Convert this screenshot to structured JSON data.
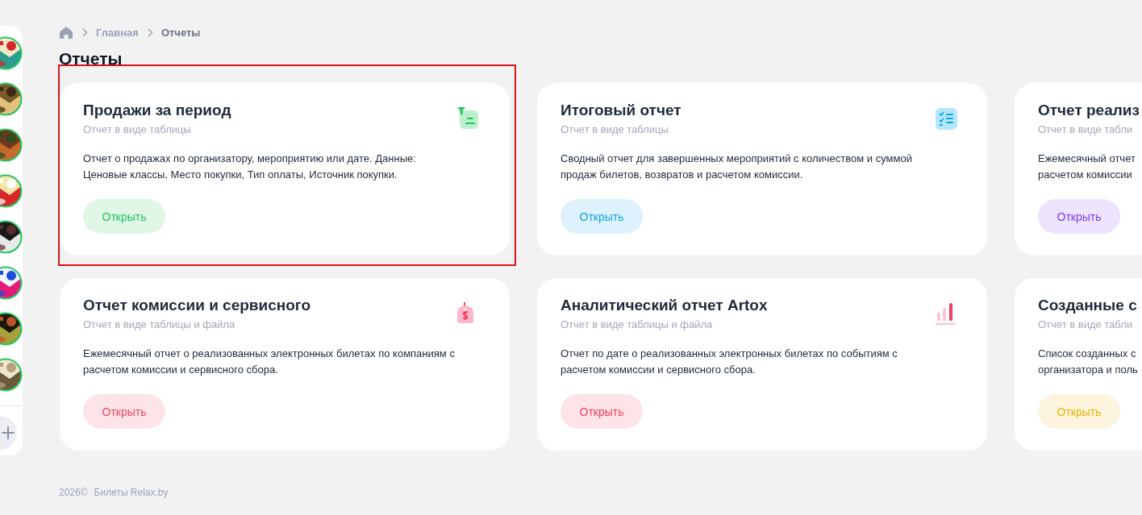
{
  "sidebar": {
    "add_button": "+"
  },
  "breadcrumb": [
    "Главная",
    "Отчеты"
  ],
  "title": "Отчеты",
  "cards": [
    {
      "title": "Продажи за период",
      "subtitle": "Отчет в виде таблицы",
      "description": [
        "Отчет о продажах по организатору, мероприятию или дате. Данные:",
        "Ценовые классы, Место покупки, Тип оплаты, Источник покупки."
      ],
      "button": "Открыть",
      "color": "#22c55e",
      "highlighted": true
    },
    {
      "title": "Итоговый отчет",
      "subtitle": "Отчет в виде таблицы",
      "description": [
        "Сводный отчет для завершенных мероприятий с количеством и суммой",
        "продаж билетов, возвратов и расчетом комиссии."
      ],
      "button": "Открыть",
      "color": "#0ea5e9",
      "highlighted": false
    },
    {
      "title": "Отчет реализ",
      "subtitle": "Отчет в виде табли",
      "description": [
        "Ежемесячный отчет",
        "расчетом комиссии"
      ],
      "button": "Открыть",
      "color": "#7c3aed",
      "highlighted": false
    },
    {
      "title": "Отчет комиссии и сервисного",
      "subtitle": "Отчет в виде таблицы и файла",
      "description": [
        "Ежемесячный отчет о реализованных электронных билетах по компаниям с",
        "расчетом комиссии и сервисного сбора."
      ],
      "button": "Открыть",
      "color": "#f43f5e",
      "highlighted": false
    },
    {
      "title": "Аналитический отчет Artox",
      "subtitle": "Отчет в виде таблицы и файла",
      "description": [
        "Отчет по дате о реализованных электронных билетах по событиям с",
        "расчетом комиссии и сервисного сбора."
      ],
      "button": "Открыть",
      "color": "#f43f5e",
      "highlighted": false
    },
    {
      "title": "Созданные с",
      "subtitle": "Отчет в виде табли",
      "description": [
        "Список созданных с",
        "организатора и поль"
      ],
      "button": "Открыть",
      "color": "#eab308",
      "highlighted": false
    }
  ],
  "footer": {
    "year": "2026©",
    "brand": "Билеты Relax.by"
  }
}
